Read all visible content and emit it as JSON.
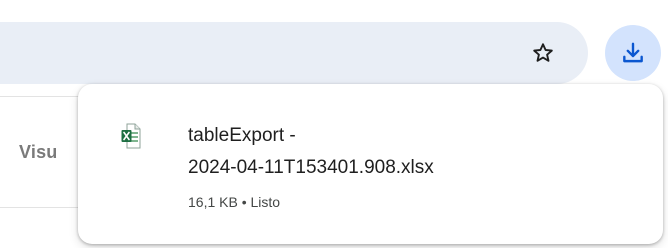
{
  "toolbar": {
    "star_icon": "star-outline-icon",
    "download_icon": "download-icon",
    "accent": "#0b57d0"
  },
  "page": {
    "tab_label": "Visu"
  },
  "downloads": {
    "items": [
      {
        "icon": "excel-file-icon",
        "name_line1": "tableExport -",
        "name_line2": "2024-04-11T153401.908.xlsx",
        "size": "16,1 KB",
        "separator": "•",
        "status": "Listo"
      }
    ]
  }
}
